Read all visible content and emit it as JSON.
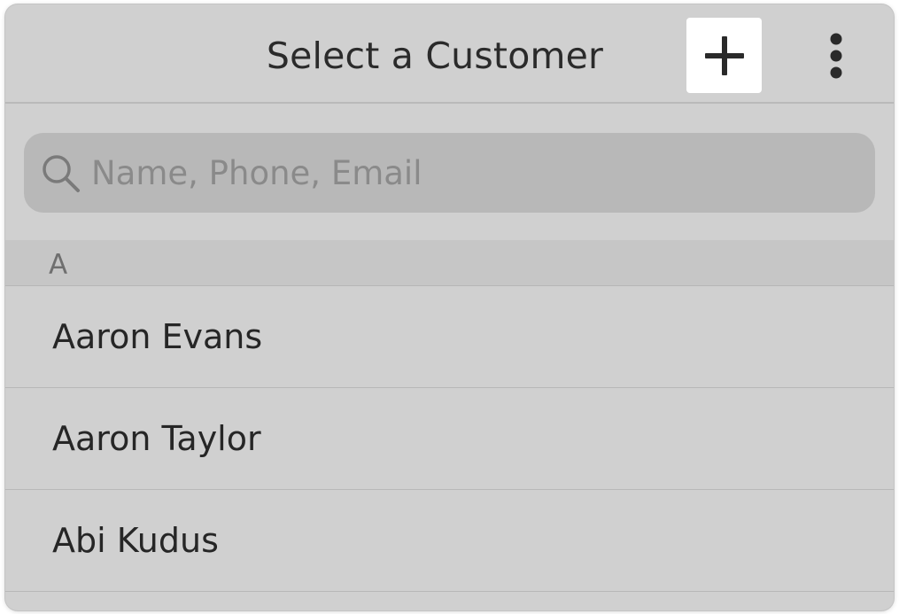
{
  "header": {
    "title": "Select a Customer",
    "add_icon": "plus-icon",
    "more_icon": "more-vertical-icon"
  },
  "search": {
    "icon": "search-icon",
    "placeholder": "Name, Phone, Email",
    "value": ""
  },
  "section": {
    "letter": "A"
  },
  "customers": [
    {
      "name": "Aaron Evans"
    },
    {
      "name": "Aaron Taylor"
    },
    {
      "name": "Abi Kudus"
    }
  ],
  "colors": {
    "background": "#d0d0d0",
    "search_field": "#b8b8b8",
    "section_header": "#c6c6c6",
    "add_button": "#ffffff",
    "text": "#2c2c2c"
  }
}
